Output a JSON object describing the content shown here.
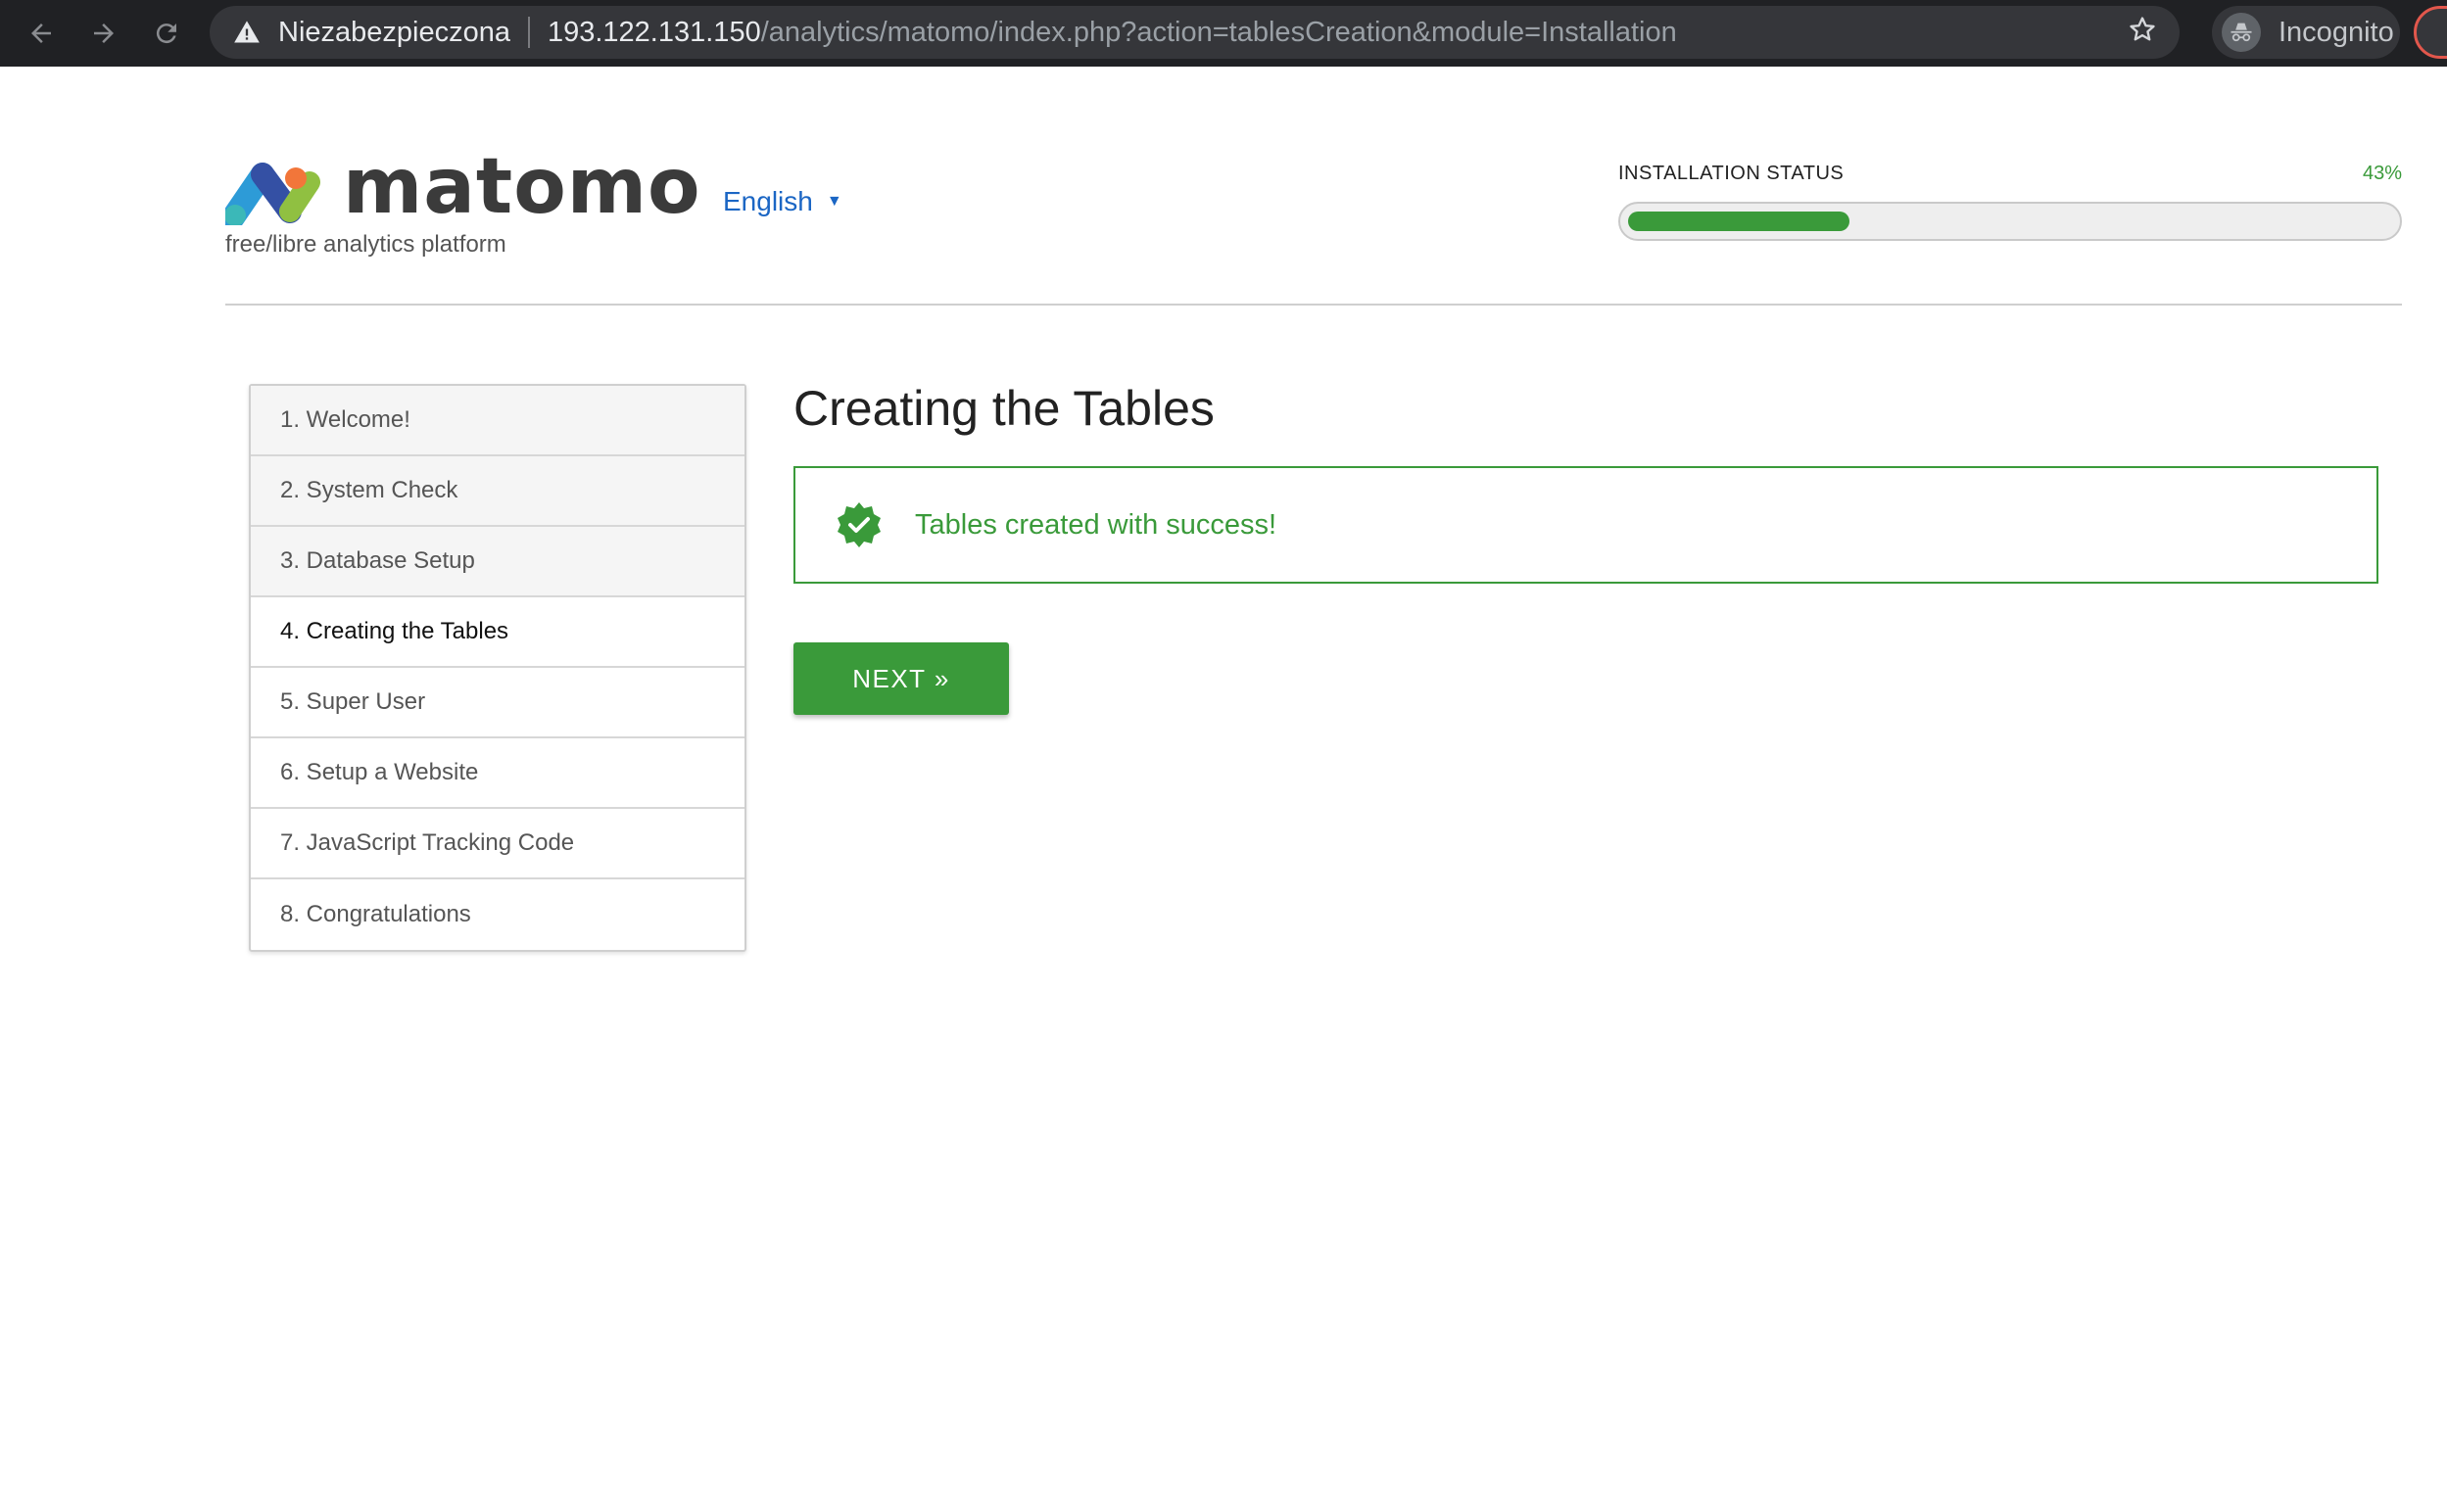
{
  "browser": {
    "security_label": "Niezabezpieczona",
    "url_host": "193.122.131.150",
    "url_path": "/analytics/matomo/index.php?action=tablesCreation&module=Installation",
    "incognito_label": "Incognito",
    "icons": [
      "back-icon",
      "forward-icon",
      "reload-icon",
      "warning-icon",
      "star-icon",
      "incognito-icon"
    ]
  },
  "header": {
    "logo_text": "matomo",
    "tagline": "free/libre analytics platform",
    "language": "English",
    "status_label": "INSTALLATION STATUS",
    "status_percent_text": "43%",
    "progress_fraction": 0.43
  },
  "steps": [
    {
      "label": "1. Welcome!",
      "state": "done"
    },
    {
      "label": "2. System Check",
      "state": "done"
    },
    {
      "label": "3. Database Setup",
      "state": "done"
    },
    {
      "label": "4. Creating the Tables",
      "state": "current"
    },
    {
      "label": "5. Super User",
      "state": "todo"
    },
    {
      "label": "6. Setup a Website",
      "state": "todo"
    },
    {
      "label": "7. JavaScript Tracking Code",
      "state": "todo"
    },
    {
      "label": "8. Congratulations",
      "state": "todo"
    }
  ],
  "main": {
    "title": "Creating the Tables",
    "success_message": "Tables created with success!",
    "next_label": "NEXT »"
  },
  "colors": {
    "accent_green": "#3a9a3a",
    "link_blue": "#1b66c4",
    "chrome_dark": "#202124"
  }
}
